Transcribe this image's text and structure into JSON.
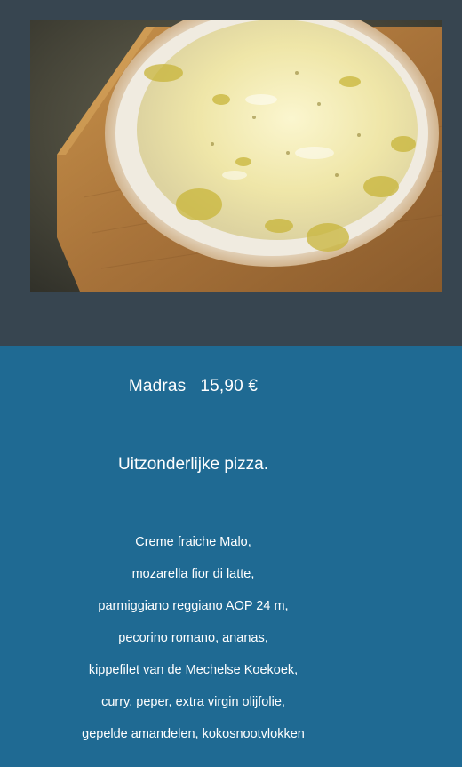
{
  "product": {
    "image_alt": "Madras pizza",
    "name": "Madras",
    "price": "15,90 €",
    "tagline": "Uitzonderlijke pizza.",
    "ingredients": [
      "Creme fraiche Malo,",
      "mozarella fior di latte,",
      "parmiggiano reggiano AOP 24 m,",
      "pecorino romano, ananas,",
      "kippefilet van de Mechelse Koekoek,",
      "curry, peper, extra virgin olijfolie,",
      "gepelde amandelen, kokosnootvlokken"
    ]
  },
  "colors": {
    "header_bg": "#374550",
    "content_bg": "#1f6a93",
    "text": "#ffffff"
  }
}
